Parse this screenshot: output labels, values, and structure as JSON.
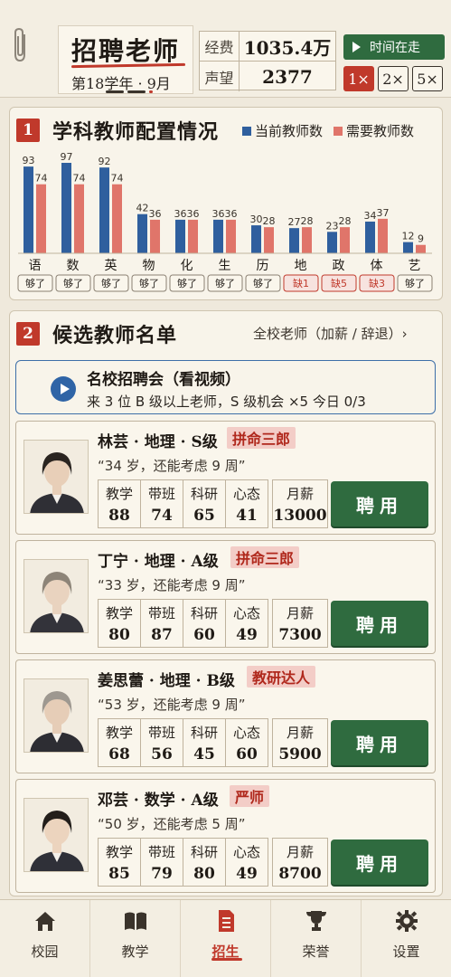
{
  "header": {
    "title": "招聘老师",
    "semester": "第18学年 · 9月",
    "stats": [
      {
        "label": "经费",
        "value": "1035.4万"
      },
      {
        "label": "声望",
        "value": "2377"
      }
    ],
    "time_button": "时间在走",
    "speeds": [
      "1×",
      "2×",
      "5×"
    ],
    "active_speed": "1×"
  },
  "section1": {
    "number": "1",
    "title": "学科教师配置情况",
    "legend_current": "当前教师数",
    "legend_needed": "需要教师数",
    "colors": {
      "current": "#2f5f9e",
      "needed": "#e0756a",
      "ok_text": "#2a2520",
      "short_text": "#c0392b"
    }
  },
  "chart_data": {
    "type": "bar",
    "categories": [
      "语",
      "数",
      "英",
      "物",
      "化",
      "生",
      "历",
      "地",
      "政",
      "体",
      "艺"
    ],
    "series": [
      {
        "name": "当前教师数",
        "values": [
          93,
          97,
          92,
          42,
          36,
          36,
          30,
          27,
          23,
          34,
          12
        ]
      },
      {
        "name": "需要教师数",
        "values": [
          74,
          74,
          74,
          36,
          36,
          36,
          28,
          28,
          28,
          37,
          9
        ]
      }
    ],
    "status": [
      "够了",
      "够了",
      "够了",
      "够了",
      "够了",
      "够了",
      "够了",
      "缺1",
      "缺5",
      "缺3",
      "够了"
    ],
    "ylim": [
      0,
      97
    ],
    "title": "",
    "xlabel": "",
    "ylabel": ""
  },
  "section2": {
    "number": "2",
    "title": "候选教师名单",
    "all_teachers_link": "全校老师（加薪 / 辞退）›",
    "fair": {
      "title": "名校招聘会（看视频）",
      "desc": "来 3 位 B 级以上老师，S 级机会 ×5   今日 0/3"
    },
    "attr_labels": [
      "教学",
      "带班",
      "科研",
      "心态",
      "月薪"
    ],
    "hire_label": "聘用",
    "candidates": [
      {
        "name": "林芸 · 地理 · S级",
        "tag": "拼命三郎",
        "quote": "“34 岁，还能考虑 9 周”",
        "teach": "88",
        "class": "74",
        "research": "65",
        "mind": "41",
        "salary": "13000"
      },
      {
        "name": "丁宁 · 地理 · A级",
        "tag": "拼命三郎",
        "quote": "“33 岁，还能考虑 9 周”",
        "teach": "80",
        "class": "87",
        "research": "60",
        "mind": "49",
        "salary": "7300"
      },
      {
        "name": "姜思蕾 · 地理 · B级",
        "tag": "教研达人",
        "quote": "“53 岁，还能考虑 9 周”",
        "teach": "68",
        "class": "56",
        "research": "45",
        "mind": "60",
        "salary": "5900"
      },
      {
        "name": "邓芸 · 数学 · A级",
        "tag": "严师",
        "quote": "“50 岁，还能考虑 5 周”",
        "teach": "85",
        "class": "79",
        "research": "80",
        "mind": "49",
        "salary": "8700"
      }
    ]
  },
  "nav": {
    "items": [
      {
        "label": "校园",
        "icon": "home-icon"
      },
      {
        "label": "教学",
        "icon": "book-icon"
      },
      {
        "label": "招生",
        "icon": "document-icon"
      },
      {
        "label": "荣誉",
        "icon": "trophy-icon"
      },
      {
        "label": "设置",
        "icon": "gear-icon"
      }
    ],
    "active": "招生"
  }
}
